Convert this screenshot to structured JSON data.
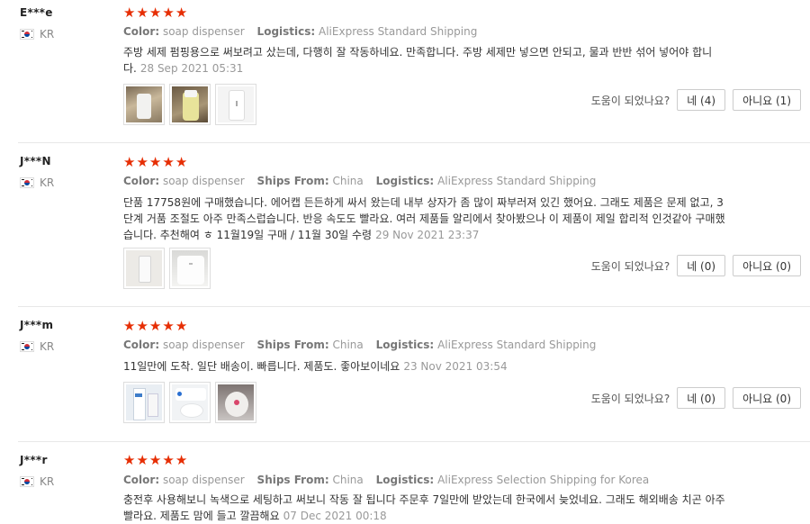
{
  "reviews": [
    {
      "user": "E***e",
      "country": "KR",
      "stars": 5,
      "color_label": "Color:",
      "color": "soap dispenser",
      "ships_label": "",
      "ships": "",
      "logistics_label": "Logistics:",
      "logistics": "AliExpress Standard Shipping",
      "text": "주방 세제 펌핑용으로 써보려고 샀는데, 다행히 잘 작동하네요. 만족합니다. 주방 세제만 넣으면 안되고, 물과 반반 섞어 넣어야 합니다.",
      "date": "28 Sep 2021 05:31",
      "thumbs": [
        "photo-dispenser-sink",
        "photo-dispenser-yellow",
        "photo-dispenser-white"
      ],
      "helpful_q": "도움이 되었나요?",
      "yes": "네 (4)",
      "no": "아니요 (1)"
    },
    {
      "user": "J***N",
      "country": "KR",
      "stars": 5,
      "color_label": "Color:",
      "color": "soap dispenser",
      "ships_label": "Ships From:",
      "ships": "China",
      "logistics_label": "Logistics:",
      "logistics": "AliExpress Standard Shipping",
      "text": "단품 17758원에 구매했습니다. 에어캡 든든하게 싸서 왔는데 내부 상자가 좀 많이 짜부러져 있긴 했어요. 그래도 제품은 문제 없고, 3단계 거품 조절도 아주 만족스럽습니다. 반응 속도도 빨라요. 여러 제품들 알리에서 찾아봤으나 이 제품이 제일 합리적 인것같아 구매했습니다. 추천해여 ㅎ 11월19일 구매 / 11월 30일 수령",
      "date": "29 Nov 2021 23:37",
      "thumbs": [
        "photo-dispenser-box",
        "photo-dispenser-closeup"
      ],
      "helpful_q": "도움이 되었나요?",
      "yes": "네 (0)",
      "no": "아니요 (0)"
    },
    {
      "user": "J***m",
      "country": "KR",
      "stars": 5,
      "color_label": "Color:",
      "color": "soap dispenser",
      "ships_label": "Ships From:",
      "ships": "China",
      "logistics_label": "Logistics:",
      "logistics": "AliExpress Standard Shipping",
      "text": "11일만에 도착. 일단 배송이. 빠릅니다. 제품도. 좋아보이네요",
      "date": "23 Nov 2021 03:54",
      "thumbs": [
        "photo-package",
        "photo-dispenser-foam",
        "photo-dispenser-sensor"
      ],
      "helpful_q": "도움이 되었나요?",
      "yes": "네 (0)",
      "no": "아니요 (0)"
    },
    {
      "user": "J***r",
      "country": "KR",
      "stars": 5,
      "color_label": "Color:",
      "color": "soap dispenser",
      "ships_label": "Ships From:",
      "ships": "China",
      "logistics_label": "Logistics:",
      "logistics": "AliExpress Selection Shipping for Korea",
      "text": "충전후 사용해보니 녹색으로 세팅하고 써보니 작동 잘 됩니다 주문후 7일만에 받았는데 한국에서 늦었네요. 그래도 해외배송 치곤 아주 빨라요. 제품도 맘에 들고 깔끔해요",
      "date": "07 Dec 2021 00:18",
      "thumbs": [],
      "helpful_q": "",
      "yes": "",
      "no": ""
    }
  ],
  "colors": {
    "star": "#e62e04",
    "meta": "#999999",
    "border": "#e8e8e8"
  }
}
